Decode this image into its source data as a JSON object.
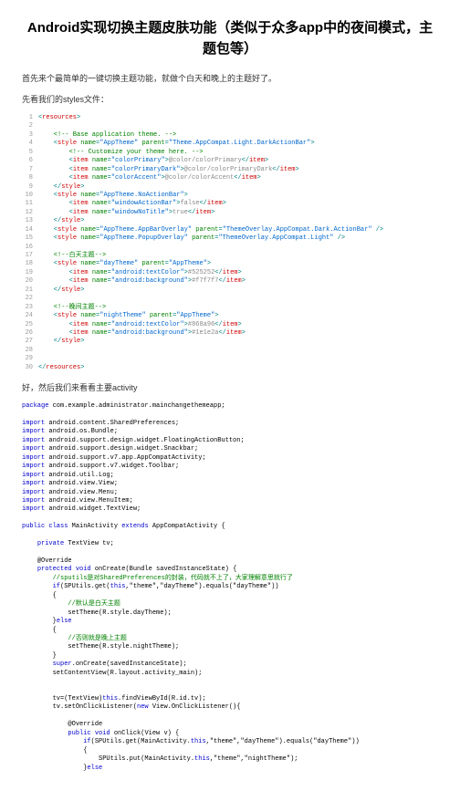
{
  "title": "Android实现切换主题皮肤功能（类似于众多app中的夜间模式，主题包等）",
  "para1": "首先来个最简单的一键切换主题功能，就做个白天和晚上的主题好了。",
  "para2": "先看我们的styles文件：",
  "xml": [
    {
      "n": "1",
      "s": [
        [
          "<",
          "teal"
        ],
        [
          "resources",
          "red"
        ],
        [
          ">",
          "teal"
        ]
      ]
    },
    {
      "n": "2",
      "s": []
    },
    {
      "n": "3",
      "s": [
        [
          "    <!-- Base application theme. -->",
          "green"
        ]
      ]
    },
    {
      "n": "4",
      "s": [
        [
          "    <",
          "teal"
        ],
        [
          "style ",
          "red"
        ],
        [
          "name",
          "green"
        ],
        [
          "=",
          "teal"
        ],
        [
          "\"AppTheme\"",
          "blue"
        ],
        [
          " parent",
          "green"
        ],
        [
          "=",
          "teal"
        ],
        [
          "\"Theme.AppCompat.Light.DarkActionBar\"",
          "blue"
        ],
        [
          ">",
          "teal"
        ]
      ]
    },
    {
      "n": "5",
      "s": [
        [
          "        <!-- Customize your theme here. -->",
          "green"
        ]
      ]
    },
    {
      "n": "6",
      "s": [
        [
          "        <",
          "teal"
        ],
        [
          "item ",
          "red"
        ],
        [
          "name",
          "green"
        ],
        [
          "=",
          "teal"
        ],
        [
          "\"colorPrimary\"",
          "blue"
        ],
        [
          ">",
          "teal"
        ],
        [
          "@color/colorPrimary",
          "gray"
        ],
        [
          "</",
          "teal"
        ],
        [
          "item",
          "red"
        ],
        [
          ">",
          "teal"
        ]
      ]
    },
    {
      "n": "7",
      "s": [
        [
          "        <",
          "teal"
        ],
        [
          "item ",
          "red"
        ],
        [
          "name",
          "green"
        ],
        [
          "=",
          "teal"
        ],
        [
          "\"colorPrimaryDark\"",
          "blue"
        ],
        [
          ">",
          "teal"
        ],
        [
          "@color/colorPrimaryDark",
          "gray"
        ],
        [
          "</",
          "teal"
        ],
        [
          "item",
          "red"
        ],
        [
          ">",
          "teal"
        ]
      ]
    },
    {
      "n": "8",
      "s": [
        [
          "        <",
          "teal"
        ],
        [
          "item ",
          "red"
        ],
        [
          "name",
          "green"
        ],
        [
          "=",
          "teal"
        ],
        [
          "\"colorAccent\"",
          "blue"
        ],
        [
          ">",
          "teal"
        ],
        [
          "@color/colorAccent",
          "gray"
        ],
        [
          "</",
          "teal"
        ],
        [
          "item",
          "red"
        ],
        [
          ">",
          "teal"
        ]
      ]
    },
    {
      "n": "9",
      "s": [
        [
          "    </",
          "teal"
        ],
        [
          "style",
          "red"
        ],
        [
          ">",
          "teal"
        ]
      ]
    },
    {
      "n": "10",
      "s": [
        [
          "    <",
          "teal"
        ],
        [
          "style ",
          "red"
        ],
        [
          "name",
          "green"
        ],
        [
          "=",
          "teal"
        ],
        [
          "\"AppTheme.NoActionBar\"",
          "blue"
        ],
        [
          ">",
          "teal"
        ]
      ]
    },
    {
      "n": "11",
      "s": [
        [
          "        <",
          "teal"
        ],
        [
          "item ",
          "red"
        ],
        [
          "name",
          "green"
        ],
        [
          "=",
          "teal"
        ],
        [
          "\"windowActionBar\"",
          "blue"
        ],
        [
          ">",
          "teal"
        ],
        [
          "false",
          "gray"
        ],
        [
          "</",
          "teal"
        ],
        [
          "item",
          "red"
        ],
        [
          ">",
          "teal"
        ]
      ]
    },
    {
      "n": "12",
      "s": [
        [
          "        <",
          "teal"
        ],
        [
          "item ",
          "red"
        ],
        [
          "name",
          "green"
        ],
        [
          "=",
          "teal"
        ],
        [
          "\"windowNoTitle\"",
          "blue"
        ],
        [
          ">",
          "teal"
        ],
        [
          "true",
          "gray"
        ],
        [
          "</",
          "teal"
        ],
        [
          "item",
          "red"
        ],
        [
          ">",
          "teal"
        ]
      ]
    },
    {
      "n": "13",
      "s": [
        [
          "    </",
          "teal"
        ],
        [
          "style",
          "red"
        ],
        [
          ">",
          "teal"
        ]
      ]
    },
    {
      "n": "14",
      "s": [
        [
          "    <",
          "teal"
        ],
        [
          "style ",
          "red"
        ],
        [
          "name",
          "green"
        ],
        [
          "=",
          "teal"
        ],
        [
          "\"AppTheme.AppBarOverlay\"",
          "blue"
        ],
        [
          " parent",
          "green"
        ],
        [
          "=",
          "teal"
        ],
        [
          "\"ThemeOverlay.AppCompat.Dark.ActionBar\"",
          "blue"
        ],
        [
          " />",
          "teal"
        ]
      ]
    },
    {
      "n": "15",
      "s": [
        [
          "    <",
          "teal"
        ],
        [
          "style ",
          "red"
        ],
        [
          "name",
          "green"
        ],
        [
          "=",
          "teal"
        ],
        [
          "\"AppTheme.PopupOverlay\"",
          "blue"
        ],
        [
          " parent",
          "green"
        ],
        [
          "=",
          "teal"
        ],
        [
          "\"ThemeOverlay.AppCompat.Light\"",
          "blue"
        ],
        [
          " />",
          "teal"
        ]
      ]
    },
    {
      "n": "16",
      "s": []
    },
    {
      "n": "17",
      "s": [
        [
          "    <!--白天主题-->",
          "green"
        ]
      ]
    },
    {
      "n": "18",
      "s": [
        [
          "    <",
          "teal"
        ],
        [
          "style ",
          "red"
        ],
        [
          "name",
          "green"
        ],
        [
          "=",
          "teal"
        ],
        [
          "\"dayTheme\"",
          "blue"
        ],
        [
          " parent",
          "green"
        ],
        [
          "=",
          "teal"
        ],
        [
          "\"AppTheme\"",
          "blue"
        ],
        [
          ">",
          "teal"
        ]
      ]
    },
    {
      "n": "19",
      "s": [
        [
          "        <",
          "teal"
        ],
        [
          "item ",
          "red"
        ],
        [
          "name",
          "green"
        ],
        [
          "=",
          "teal"
        ],
        [
          "\"android:textColor\"",
          "blue"
        ],
        [
          ">",
          "teal"
        ],
        [
          "#525252",
          "gray"
        ],
        [
          "</",
          "teal"
        ],
        [
          "item",
          "red"
        ],
        [
          ">",
          "teal"
        ]
      ]
    },
    {
      "n": "20",
      "s": [
        [
          "        <",
          "teal"
        ],
        [
          "item ",
          "red"
        ],
        [
          "name",
          "green"
        ],
        [
          "=",
          "teal"
        ],
        [
          "\"android:background\"",
          "blue"
        ],
        [
          ">",
          "teal"
        ],
        [
          "#f7f7f7",
          "gray"
        ],
        [
          "</",
          "teal"
        ],
        [
          "item",
          "red"
        ],
        [
          ">",
          "teal"
        ]
      ]
    },
    {
      "n": "21",
      "s": [
        [
          "    </",
          "teal"
        ],
        [
          "style",
          "red"
        ],
        [
          ">",
          "teal"
        ]
      ]
    },
    {
      "n": "22",
      "s": []
    },
    {
      "n": "23",
      "s": [
        [
          "    <!--晚间主题-->",
          "green"
        ]
      ]
    },
    {
      "n": "24",
      "s": [
        [
          "    <",
          "teal"
        ],
        [
          "style ",
          "red"
        ],
        [
          "name",
          "green"
        ],
        [
          "=",
          "teal"
        ],
        [
          "\"nightTheme\"",
          "blue"
        ],
        [
          " parent",
          "green"
        ],
        [
          "=",
          "teal"
        ],
        [
          "\"AppTheme\"",
          "blue"
        ],
        [
          ">",
          "teal"
        ]
      ]
    },
    {
      "n": "25",
      "s": [
        [
          "        <",
          "teal"
        ],
        [
          "item ",
          "red"
        ],
        [
          "name",
          "green"
        ],
        [
          "=",
          "teal"
        ],
        [
          "\"android:textColor\"",
          "blue"
        ],
        [
          ">",
          "teal"
        ],
        [
          "#868a96",
          "gray"
        ],
        [
          "</",
          "teal"
        ],
        [
          "item",
          "red"
        ],
        [
          ">",
          "teal"
        ]
      ]
    },
    {
      "n": "26",
      "s": [
        [
          "        <",
          "teal"
        ],
        [
          "item ",
          "red"
        ],
        [
          "name",
          "green"
        ],
        [
          "=",
          "teal"
        ],
        [
          "\"android:background\"",
          "blue"
        ],
        [
          ">",
          "teal"
        ],
        [
          "#1e1e2a",
          "gray"
        ],
        [
          "</",
          "teal"
        ],
        [
          "item",
          "red"
        ],
        [
          ">",
          "teal"
        ]
      ]
    },
    {
      "n": "27",
      "s": [
        [
          "    </",
          "teal"
        ],
        [
          "style",
          "red"
        ],
        [
          ">",
          "teal"
        ]
      ]
    },
    {
      "n": "28",
      "s": []
    },
    {
      "n": "29",
      "s": []
    },
    {
      "n": "30",
      "s": [
        [
          "</",
          "teal"
        ],
        [
          "resources",
          "red"
        ],
        [
          ">",
          "teal"
        ]
      ]
    }
  ],
  "para3": "好，然后我们来看看主要activity",
  "java": {
    "pkg_kw": "package",
    "pkg": " com.example.administrator.mainchangethemeapp;",
    "imp_kw": "import",
    "imports": [
      " android.content.SharedPreferences;",
      " android.os.Bundle;",
      " android.support.design.widget.FloatingActionButton;",
      " android.support.design.widget.Snackbar;",
      " android.support.v7.app.AppCompatActivity;",
      " android.support.v7.widget.Toolbar;",
      " android.util.Log;",
      " android.view.View;",
      " android.view.Menu;",
      " android.view.MenuItem;",
      " android.widget.TextView;"
    ],
    "cls_line": {
      "public": "public",
      "class": "class",
      "name": " MainActivity ",
      "extends": "extends",
      "ext": " AppCompatActivity {"
    },
    "priv_kw": "private",
    "priv_rest": " TextView tv;",
    "override": "@Override",
    "prot_kw": "protected",
    "void_kw": "void",
    "oncreate": " onCreate(Bundle savedInstanceState) {",
    "com1": "//sputils是对SharedPreferences的封装，代码就不上了，大家理解意思就行了",
    "if_kw": "if",
    "this_kw": "this",
    "ifline1_a": "(SPUtils.get(",
    "ifline1_b": ",\"theme\",\"dayTheme\").equals(\"dayTheme\"))",
    "brace_open": "{",
    "brace_close": "}",
    "com2": "//默认是白天主题",
    "settheme_day": "    setTheme(R.style.dayTheme);",
    "else_kw": "else",
    "com3": "//否则就是晚上主题",
    "settheme_night": "    setTheme(R.style.nightTheme);",
    "super_kw": "super",
    "super_rest": ".onCreate(savedInstanceState);",
    "setcontent": "setContentView(R.layout.activity_main);",
    "tvline_a": "tv=(TextView)",
    "tvline_b": ".findViewById(R.id.tv);",
    "new_kw": "new",
    "setclick_a": "tv.setOnClickListener(",
    "setclick_b": " View.OnClickListener(){",
    "public_kw": "public",
    "onclick": " onClick(View v) {",
    "ifline2_a": "(SPUtils.get(MainActivity.",
    "ifline2_b": ",\"theme\",\"dayTheme\").equals(\"dayTheme\"))",
    "spput_a": "    SPUtils.put(MainActivity.",
    "spput_b": ",\"theme\",\"nightTheme\");"
  }
}
